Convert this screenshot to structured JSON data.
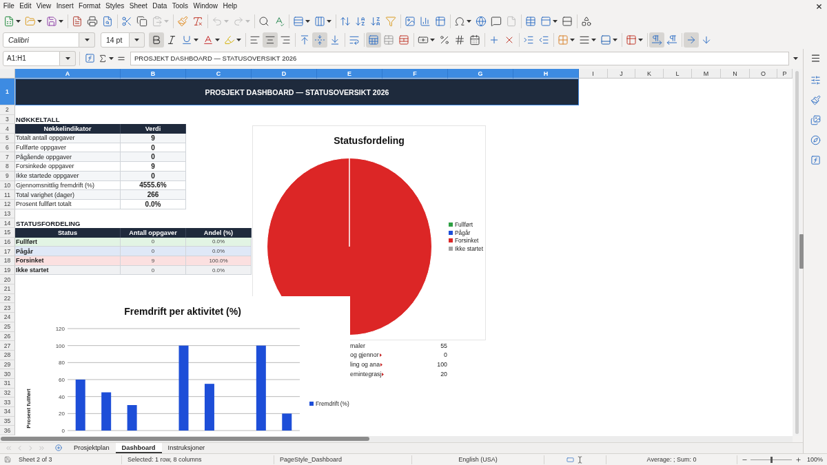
{
  "menu_bar": {
    "items": [
      "File",
      "Edit",
      "View",
      "Insert",
      "Format",
      "Styles",
      "Sheet",
      "Data",
      "Tools",
      "Window",
      "Help"
    ]
  },
  "standard_toolbar": [
    [
      {
        "kind": "new",
        "disabled": false
      },
      {
        "kind": "open",
        "disabled": false
      },
      {
        "kind": "save",
        "disabled": false
      }
    ],
    [
      {
        "kind": "export_pdf",
        "disabled": false
      },
      {
        "kind": "print",
        "disabled": false
      },
      {
        "kind": "print_preview",
        "disabled": false
      }
    ],
    [
      {
        "kind": "cut",
        "disabled": false
      },
      {
        "kind": "copy",
        "disabled": false
      },
      {
        "kind": "paste",
        "disabled": true
      }
    ],
    [
      {
        "kind": "clone_formatting",
        "disabled": false
      },
      {
        "kind": "clear_formatting",
        "disabled": false
      }
    ],
    [
      {
        "kind": "undo",
        "disabled": true
      },
      {
        "kind": "redo",
        "disabled": true
      }
    ],
    [
      {
        "kind": "find_replace",
        "disabled": false
      },
      {
        "kind": "spelling",
        "disabled": false
      }
    ],
    [
      {
        "kind": "row",
        "disabled": false
      },
      {
        "kind": "column",
        "disabled": false
      }
    ],
    [
      {
        "kind": "sort",
        "disabled": false
      },
      {
        "kind": "sort_ascending",
        "disabled": false
      },
      {
        "kind": "sort_descending",
        "disabled": false
      },
      {
        "kind": "autofilter",
        "disabled": false
      }
    ],
    [
      {
        "kind": "image",
        "disabled": false
      },
      {
        "kind": "chart",
        "disabled": false
      },
      {
        "kind": "pivot_table",
        "disabled": false
      }
    ],
    [
      {
        "kind": "special_character",
        "disabled": false
      },
      {
        "kind": "hyperlink",
        "disabled": false
      },
      {
        "kind": "comment",
        "disabled": false
      },
      {
        "kind": "header_footer",
        "disabled": true
      }
    ],
    [
      {
        "kind": "print_area",
        "disabled": false
      },
      {
        "kind": "freeze",
        "disabled": false
      },
      {
        "kind": "split_window",
        "disabled": false
      }
    ],
    [
      {
        "kind": "shapes",
        "disabled": false
      }
    ]
  ],
  "formatting_toolbar": {
    "font_name": "Calibri",
    "font_size": "14 pt",
    "groups": [
      [
        {
          "kind": "bold",
          "pressed": true
        },
        {
          "kind": "italic",
          "pressed": false
        },
        {
          "kind": "underline",
          "pressed": false
        },
        {
          "kind": "font_color",
          "pressed": false
        },
        {
          "kind": "highlight",
          "pressed": false
        }
      ],
      [
        {
          "kind": "align_left",
          "pressed": false
        },
        {
          "kind": "align_center",
          "pressed": true
        },
        {
          "kind": "align_right",
          "pressed": false
        }
      ],
      [
        {
          "kind": "align_top",
          "pressed": false
        },
        {
          "kind": "align_middle",
          "pressed": true
        },
        {
          "kind": "align_bottom",
          "pressed": false
        }
      ],
      [
        {
          "kind": "wrap_text",
          "pressed": false
        }
      ],
      [
        {
          "kind": "merge_center",
          "pressed": true
        },
        {
          "kind": "merge",
          "pressed": false
        },
        {
          "kind": "unmerge",
          "pressed": false
        }
      ],
      [
        {
          "kind": "currency",
          "pressed": false
        },
        {
          "kind": "percent",
          "pressed": false
        },
        {
          "kind": "number",
          "pressed": false
        },
        {
          "kind": "date",
          "pressed": false
        }
      ],
      [
        {
          "kind": "add_decimal",
          "pressed": false
        },
        {
          "kind": "delete_decimal",
          "pressed": false
        }
      ],
      [
        {
          "kind": "indent_increase",
          "pressed": false
        },
        {
          "kind": "indent_decrease",
          "pressed": false
        }
      ],
      [
        {
          "kind": "borders",
          "pressed": false
        },
        {
          "kind": "border_style",
          "pressed": false
        },
        {
          "kind": "border_color",
          "pressed": false
        }
      ],
      [
        {
          "kind": "conditional",
          "pressed": false
        }
      ],
      [
        {
          "kind": "paragraph_ltr",
          "pressed": true
        },
        {
          "kind": "paragraph_rtl",
          "pressed": false
        }
      ],
      [
        {
          "kind": "text_ltr",
          "pressed": true
        },
        {
          "kind": "text_ttb",
          "pressed": false
        }
      ]
    ]
  },
  "formula_bar": {
    "name_box": "A1:H1",
    "content": "PROSJEKT DASHBOARD — STATUSOVERSIKT 2026"
  },
  "sheet": {
    "columns": [
      {
        "label": "A",
        "selected": true
      },
      {
        "label": "B",
        "selected": true
      },
      {
        "label": "C",
        "selected": true
      },
      {
        "label": "D",
        "selected": true
      },
      {
        "label": "E",
        "selected": true
      },
      {
        "label": "F",
        "selected": true
      },
      {
        "label": "G",
        "selected": true
      },
      {
        "label": "H",
        "selected": true
      },
      {
        "label": "I",
        "selected": false
      },
      {
        "label": "J",
        "selected": false
      },
      {
        "label": "K",
        "selected": false
      },
      {
        "label": "L",
        "selected": false
      },
      {
        "label": "M",
        "selected": false
      },
      {
        "label": "N",
        "selected": false
      },
      {
        "label": "O",
        "selected": false
      },
      {
        "label": "P",
        "selected": false
      }
    ],
    "rows": [
      {
        "label": "1",
        "selected": true
      },
      {
        "label": "2",
        "selected": false
      },
      {
        "label": "3",
        "selected": false
      },
      {
        "label": "4",
        "selected": false
      },
      {
        "label": "5",
        "selected": false
      },
      {
        "label": "6",
        "selected": false
      },
      {
        "label": "7",
        "selected": false
      },
      {
        "label": "8",
        "selected": false
      },
      {
        "label": "9",
        "selected": false
      },
      {
        "label": "10",
        "selected": false
      },
      {
        "label": "11",
        "selected": false
      },
      {
        "label": "12",
        "selected": false
      },
      {
        "label": "13",
        "selected": false
      },
      {
        "label": "14",
        "selected": false
      },
      {
        "label": "15",
        "selected": false
      },
      {
        "label": "16",
        "selected": false
      },
      {
        "label": "17",
        "selected": false
      },
      {
        "label": "18",
        "selected": false
      },
      {
        "label": "19",
        "selected": false
      },
      {
        "label": "20",
        "selected": false
      },
      {
        "label": "21",
        "selected": false
      },
      {
        "label": "22",
        "selected": false
      },
      {
        "label": "23",
        "selected": false
      },
      {
        "label": "24",
        "selected": false
      },
      {
        "label": "25",
        "selected": false
      },
      {
        "label": "26",
        "selected": false
      },
      {
        "label": "27",
        "selected": false
      },
      {
        "label": "28",
        "selected": false
      },
      {
        "label": "29",
        "selected": false
      },
      {
        "label": "30",
        "selected": false
      },
      {
        "label": "31",
        "selected": false
      },
      {
        "label": "32",
        "selected": false
      },
      {
        "label": "33",
        "selected": false
      },
      {
        "label": "34",
        "selected": false
      },
      {
        "label": "35",
        "selected": false
      },
      {
        "label": "36",
        "selected": false
      }
    ],
    "title": "PROSJEKT DASHBOARD — STATUSOVERSIKT 2026",
    "kpi": {
      "heading": "NØKKELTALL",
      "columns": [
        "Nøkkelindikator",
        "Verdi"
      ],
      "rows": [
        {
          "label": "Totalt antall oppgaver",
          "value": "9"
        },
        {
          "label": "Fullførte oppgaver",
          "value": "0"
        },
        {
          "label": "Pågående oppgaver",
          "value": "0"
        },
        {
          "label": "Forsinkede oppgaver",
          "value": "9"
        },
        {
          "label": "Ikke startede oppgaver",
          "value": "0"
        },
        {
          "label": "Gjennomsnittlig fremdrift (%)",
          "value": "4555.6%"
        },
        {
          "label": "Total varighet (dager)",
          "value": "266"
        },
        {
          "label": "Prosent fullført totalt",
          "value": "0.0%"
        }
      ]
    },
    "status": {
      "heading": "STATUSFORDELING",
      "columns": [
        "Status",
        "Antall oppgaver",
        "Andel (%)"
      ],
      "rows": [
        {
          "status": "Fullført",
          "count": "0",
          "share": "0.0%",
          "color": "#e2f4e4"
        },
        {
          "status": "Pågår",
          "count": "0",
          "share": "0.0%",
          "color": "#dfe8f7"
        },
        {
          "status": "Forsinket",
          "count": "9",
          "share": "100.0%",
          "color": "#fbe0e0"
        },
        {
          "status": "Ikke startet",
          "count": "0",
          "share": "0.0%",
          "color": "#f0f1f3"
        }
      ]
    },
    "partial_rows": [
      {
        "text": "maler",
        "overflow": false,
        "number": "55"
      },
      {
        "text": "og gjennor",
        "overflow": true,
        "number": "0"
      },
      {
        "text": "ling og ana",
        "overflow": true,
        "number": "100"
      },
      {
        "text": "emintegrasj",
        "overflow": true,
        "number": "20"
      }
    ],
    "pie_chart": {
      "chart_data": {
        "type": "pie",
        "title": "Statusfordeling",
        "categories": [
          "Fullført",
          "Pågår",
          "Forsinket",
          "Ikke startet"
        ],
        "values": [
          0,
          0,
          100,
          0
        ]
      },
      "legend": [
        {
          "color": "#2ea043"
        },
        {
          "color": "#1d4ed8"
        },
        {
          "color": "#dc2626"
        },
        {
          "color": "#a3a3a3"
        }
      ]
    },
    "bar_chart": {
      "chart_data": {
        "type": "bar",
        "title": "Fremdrift per aktivitet (%)",
        "ylabel": "Prosent fullført",
        "series": [
          {
            "name": "Fremdrift (%)",
            "color": "#1d4ed8",
            "values": [
              60,
              45,
              30,
              0,
              100,
              55,
              0,
              100,
              20
            ]
          }
        ],
        "ylim": [
          0,
          120
        ],
        "yticks": [
          0,
          20,
          40,
          60,
          80,
          100,
          120
        ],
        "grid": true
      }
    }
  },
  "sheet_tabs": [
    {
      "label": "Prosjektplan",
      "selected": false
    },
    {
      "label": "Dashboard",
      "selected": true
    },
    {
      "label": "Instruksjoner",
      "selected": false
    }
  ],
  "status_bar": {
    "sheet": "Sheet 2 of 3",
    "selection": "Selected: 1 row, 8 columns",
    "page_style": "PageStyle_Dashboard",
    "language": "English (USA)",
    "summary": "Average: ; Sum: 0",
    "zoom": {
      "level": 0.5
    },
    "zoom_label": "100%"
  }
}
